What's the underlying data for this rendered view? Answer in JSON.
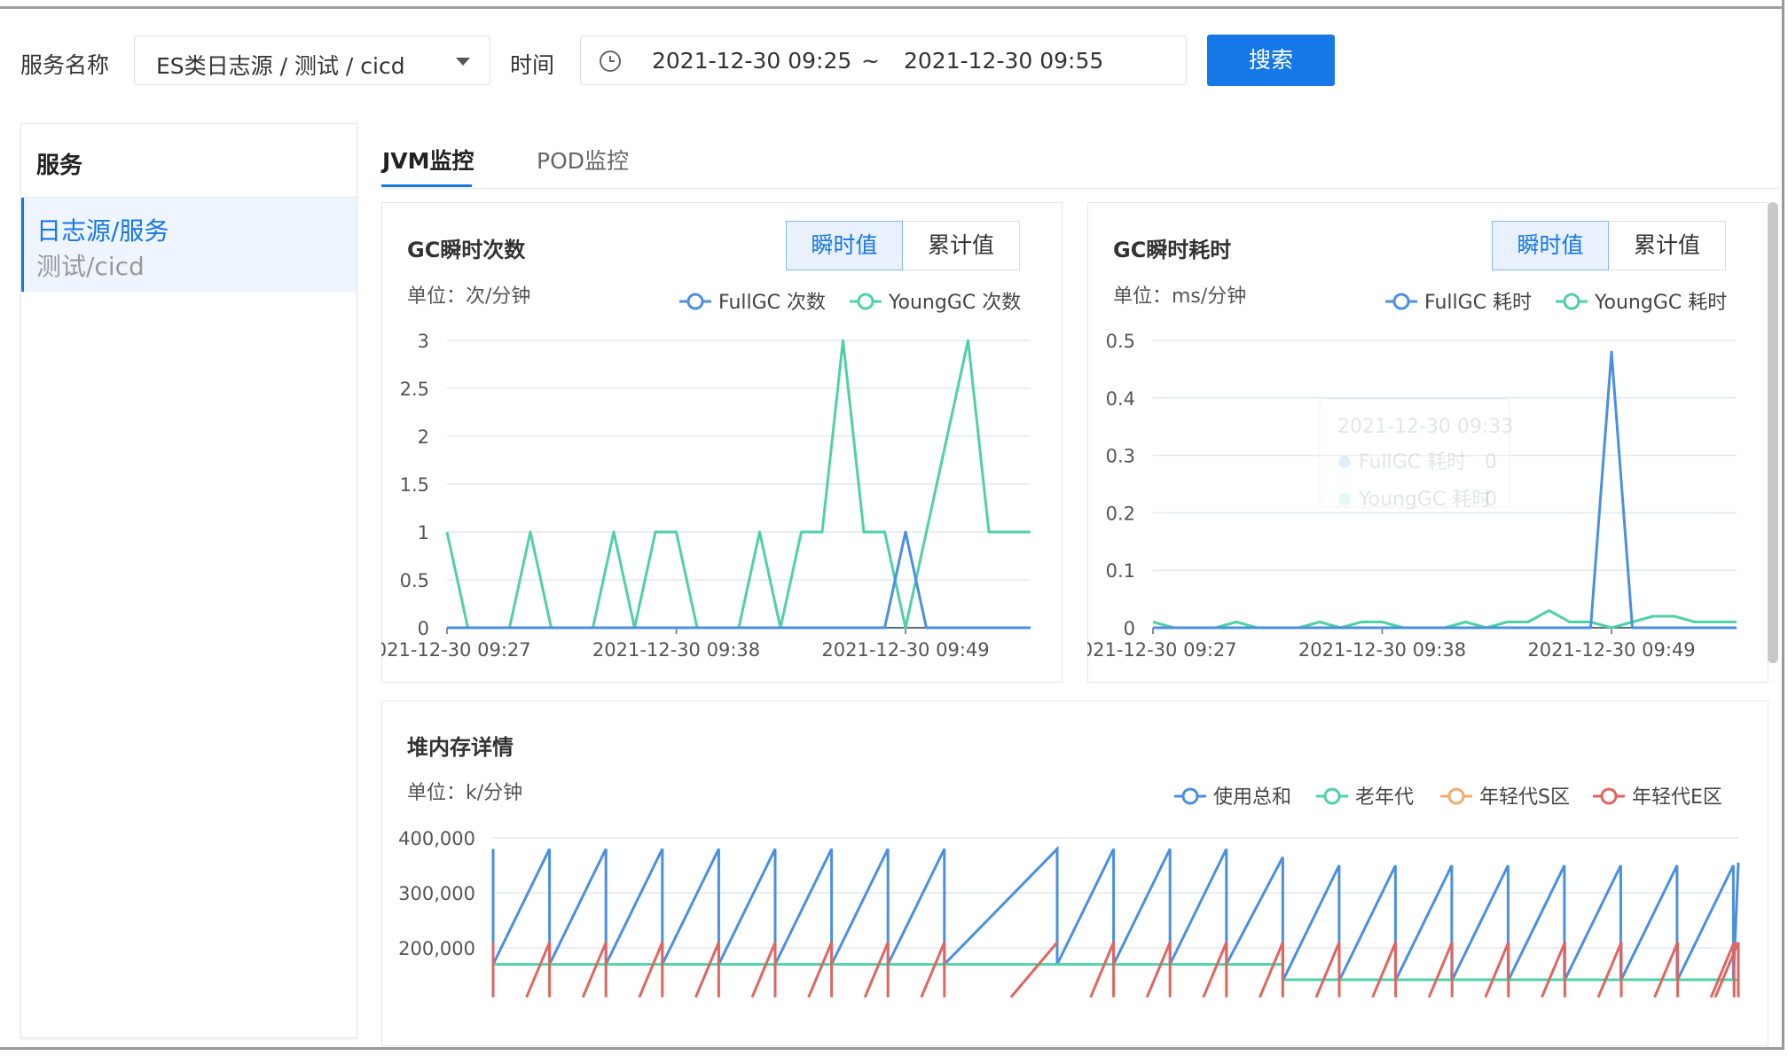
{
  "filter": {
    "service_label": "服务名称",
    "service_value": "ES类日志源 / 测试 / cicd",
    "time_label": "时间",
    "time_start": "2021-12-30 09:25",
    "time_sep": "~",
    "time_end": "2021-12-30 09:55",
    "search_label": "搜索"
  },
  "sidebar": {
    "title": "服务",
    "item_line1": "日志源/服务",
    "item_line2": "测试/cicd"
  },
  "tabs": [
    "JVM监控",
    "POD监控"
  ],
  "toggle": {
    "instant": "瞬时值",
    "cumulative": "累计值"
  },
  "colors": {
    "blue": "#4a8fe2",
    "green": "#4fd1a5",
    "orange": "#f5a96a",
    "red": "#e06560",
    "accent": "#1677e6"
  },
  "gc_count": {
    "title": "GC瞬时次数",
    "unit": "单位：次/分钟",
    "legend": [
      "FullGC 次数",
      "YoungGC 次数"
    ],
    "chart_data": {
      "type": "line",
      "ylim": [
        0,
        3
      ],
      "yticks": [
        "0",
        "0.5",
        "1",
        "1.5",
        "2",
        "2.5",
        "3"
      ],
      "xticks": [
        {
          "i": 0,
          "label": "2021-12-30 09:27"
        },
        {
          "i": 11,
          "label": "2021-12-30 09:38"
        },
        {
          "i": 22,
          "label": "2021-12-30 09:49"
        }
      ],
      "x": [
        "09:27",
        "09:28",
        "09:29",
        "09:30",
        "09:31",
        "09:32",
        "09:33",
        "09:34",
        "09:35",
        "09:36",
        "09:37",
        "09:38",
        "09:39",
        "09:40",
        "09:41",
        "09:42",
        "09:43",
        "09:44",
        "09:45",
        "09:46",
        "09:47",
        "09:48",
        "09:49",
        "09:50",
        "09:51",
        "09:52",
        "09:53",
        "09:54",
        "09:55"
      ],
      "series": [
        {
          "name": "FullGC 次数",
          "values": [
            0,
            0,
            0,
            0,
            0,
            0,
            0,
            0,
            0,
            0,
            0,
            0,
            0,
            0,
            0,
            0,
            0,
            0,
            0,
            0,
            0,
            0,
            1,
            0,
            0,
            0,
            0,
            0,
            0
          ]
        },
        {
          "name": "YoungGC 次数",
          "values": [
            1,
            0,
            0,
            0,
            1,
            0,
            0,
            0,
            1,
            0,
            1,
            1,
            0,
            0,
            0,
            1,
            0,
            1,
            1,
            3,
            1,
            1,
            0,
            1,
            2,
            3,
            1,
            1,
            1
          ]
        }
      ]
    }
  },
  "gc_time": {
    "title": "GC瞬时耗时",
    "unit": "单位：ms/分钟",
    "legend": [
      "FullGC 耗时",
      "YoungGC 耗时"
    ],
    "tooltip": {
      "time": "2021-12-30 09:33",
      "rows": [
        {
          "name": "FullGC 耗时",
          "value": "0"
        },
        {
          "name": "YoungGC 耗时",
          "value": "0"
        }
      ]
    },
    "chart_data": {
      "type": "line",
      "ylim": [
        0,
        0.5
      ],
      "yticks": [
        "0",
        "0.1",
        "0.2",
        "0.3",
        "0.4",
        "0.5"
      ],
      "xticks": [
        {
          "i": 0,
          "label": "2021-12-30 09:27"
        },
        {
          "i": 11,
          "label": "2021-12-30 09:38"
        },
        {
          "i": 22,
          "label": "2021-12-30 09:49"
        }
      ],
      "x": [
        "09:27",
        "09:28",
        "09:29",
        "09:30",
        "09:31",
        "09:32",
        "09:33",
        "09:34",
        "09:35",
        "09:36",
        "09:37",
        "09:38",
        "09:39",
        "09:40",
        "09:41",
        "09:42",
        "09:43",
        "09:44",
        "09:45",
        "09:46",
        "09:47",
        "09:48",
        "09:49",
        "09:50",
        "09:51",
        "09:52",
        "09:53",
        "09:54",
        "09:55"
      ],
      "series": [
        {
          "name": "FullGC 耗时",
          "values": [
            0,
            0,
            0,
            0,
            0,
            0,
            0,
            0,
            0,
            0,
            0,
            0,
            0,
            0,
            0,
            0,
            0,
            0,
            0,
            0,
            0,
            0,
            0.48,
            0,
            0,
            0,
            0,
            0,
            0
          ]
        },
        {
          "name": "YoungGC 耗时",
          "values": [
            0.01,
            0,
            0,
            0,
            0.01,
            0,
            0,
            0,
            0.01,
            0,
            0.01,
            0.01,
            0,
            0,
            0,
            0.01,
            0,
            0.01,
            0.01,
            0.03,
            0.01,
            0.01,
            0,
            0.01,
            0.02,
            0.02,
            0.01,
            0.01,
            0.01
          ]
        }
      ]
    }
  },
  "heap": {
    "title": "堆内存详情",
    "unit": "单位：k/分钟",
    "legend": [
      "使用总和",
      "老年代",
      "年轻代S区",
      "年轻代E区"
    ],
    "chart_data": {
      "type": "line",
      "ylim": [
        100000,
        400000
      ],
      "yticks": [
        "400,000",
        "300,000",
        "200,000"
      ],
      "ytick_values": [
        400000,
        300000,
        200000
      ],
      "total": {
        "name": "使用总和",
        "cycles_first": [
          [
            170000,
            380000
          ],
          [
            170000,
            380000
          ],
          [
            170000,
            380000
          ],
          [
            170000,
            380000
          ],
          [
            170000,
            380000
          ],
          [
            170000,
            380000
          ],
          [
            170000,
            380000
          ],
          [
            170000,
            380000
          ]
        ],
        "gap_peak": 380000,
        "cycles_mid": [
          [
            170000,
            380000
          ],
          [
            170000,
            380000
          ],
          [
            170000,
            380000
          ],
          [
            170000,
            365000
          ]
        ],
        "cycles_last": [
          [
            140000,
            350000
          ],
          [
            140000,
            350000
          ],
          [
            140000,
            350000
          ],
          [
            140000,
            350000
          ],
          [
            140000,
            350000
          ],
          [
            140000,
            350000
          ],
          [
            140000,
            350000
          ],
          [
            140000,
            350000
          ],
          [
            140000,
            355000
          ]
        ]
      },
      "old_gen": {
        "name": "老年代",
        "first": 170000,
        "last": 142000
      },
      "young_e": {
        "name": "年轻代E区",
        "low": 110000,
        "high": 210000
      }
    }
  }
}
